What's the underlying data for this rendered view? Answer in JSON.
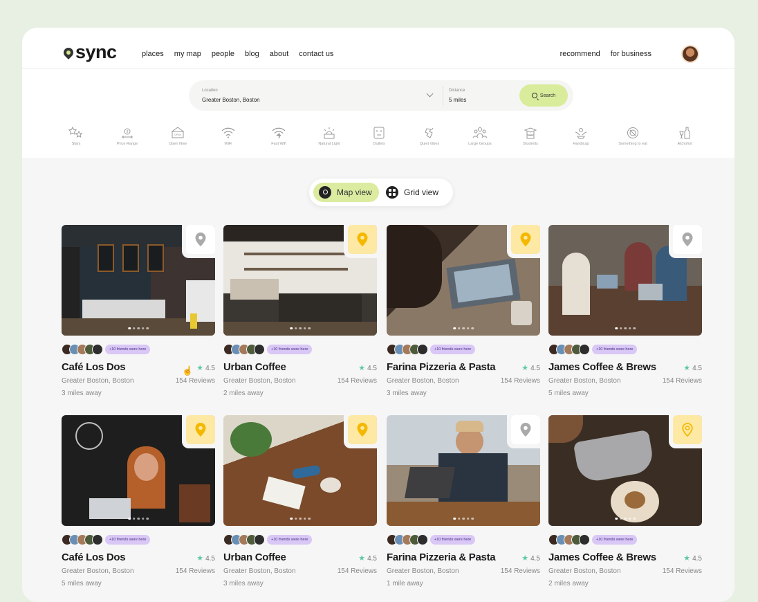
{
  "brand": {
    "name": "sync"
  },
  "nav": [
    "places",
    "my map",
    "people",
    "blog",
    "about",
    "contact us"
  ],
  "right_nav": [
    "recommend",
    "for business"
  ],
  "search": {
    "location_label": "Location",
    "location_value": "Greater Boston, Boston",
    "distance_label": "Distance",
    "distance_value": "5 miles",
    "button": "Search"
  },
  "filters": [
    {
      "label": "Stars",
      "icon": "stars-icon"
    },
    {
      "label": "Price Range",
      "icon": "price-range-icon"
    },
    {
      "label": "Open Now",
      "icon": "open-sign-icon"
    },
    {
      "label": "WiFi",
      "icon": "wifi-icon"
    },
    {
      "label": "Fast Wifi",
      "icon": "fast-wifi-icon"
    },
    {
      "label": "Natural Light",
      "icon": "sunlight-icon"
    },
    {
      "label": "Outlets",
      "icon": "outlet-icon"
    },
    {
      "label": "Quiet Vibes",
      "icon": "quiet-icon"
    },
    {
      "label": "Large Groups",
      "icon": "group-icon"
    },
    {
      "label": "Students",
      "icon": "student-icon"
    },
    {
      "label": "Handicap",
      "icon": "accessibility-icon"
    },
    {
      "label": "Something to eat",
      "icon": "food-icon"
    },
    {
      "label": "Alchohol",
      "icon": "alcohol-icon"
    }
  ],
  "view_toggle": {
    "map": "Map view",
    "grid": "Grid view",
    "active": "map"
  },
  "places": [
    {
      "name": "Café Los Dos",
      "rating": "4.5",
      "location": "Greater Boston, Boston",
      "reviews": "154 Reviews",
      "distance": "3 miles away",
      "friends": "+10 friends were here",
      "pin": "grey"
    },
    {
      "name": "Urban Coffee",
      "rating": "4.5",
      "location": "Greater Boston, Boston",
      "reviews": "154 Reviews",
      "distance": "2 miles away",
      "friends": "+10 friends were here",
      "pin": "yellow"
    },
    {
      "name": "Farina Pizzeria & Pasta",
      "rating": "4.5",
      "location": "Greater Boston, Boston",
      "reviews": "154 Reviews",
      "distance": "3 miles away",
      "friends": "+10 friends were here",
      "pin": "yellow"
    },
    {
      "name": "James Coffee & Brews",
      "rating": "4.5",
      "location": "Greater Boston, Boston",
      "reviews": "154 Reviews",
      "distance": "5 miles away",
      "friends": "+10 friends were here",
      "pin": "grey"
    },
    {
      "name": "Café Los Dos",
      "rating": "4.5",
      "location": "Greater Boston, Boston",
      "reviews": "154 Reviews",
      "distance": "5 miles away",
      "friends": "+10 friends were here",
      "pin": "yellow"
    },
    {
      "name": "Urban Coffee",
      "rating": "4.5",
      "location": "Greater Boston, Boston",
      "reviews": "154 Reviews",
      "distance": "3 miles away",
      "friends": "+10 friends were here",
      "pin": "yellow"
    },
    {
      "name": "Farina Pizzeria & Pasta",
      "rating": "4.5",
      "location": "Greater Boston, Boston",
      "reviews": "154 Reviews",
      "distance": "1 mile away",
      "friends": "+10 friends were here",
      "pin": "grey"
    },
    {
      "name": "James Coffee & Brews",
      "rating": "4.5",
      "location": "Greater Boston, Boston",
      "reviews": "154 Reviews",
      "distance": "2 miles away",
      "friends": "+10 friends were here",
      "pin": "yellow-outline"
    }
  ],
  "colors": {
    "accent": "#d9ec9b",
    "pin_yellow": "#f5b800",
    "badge": "#d9c7f5",
    "star": "#5bc9a3"
  }
}
